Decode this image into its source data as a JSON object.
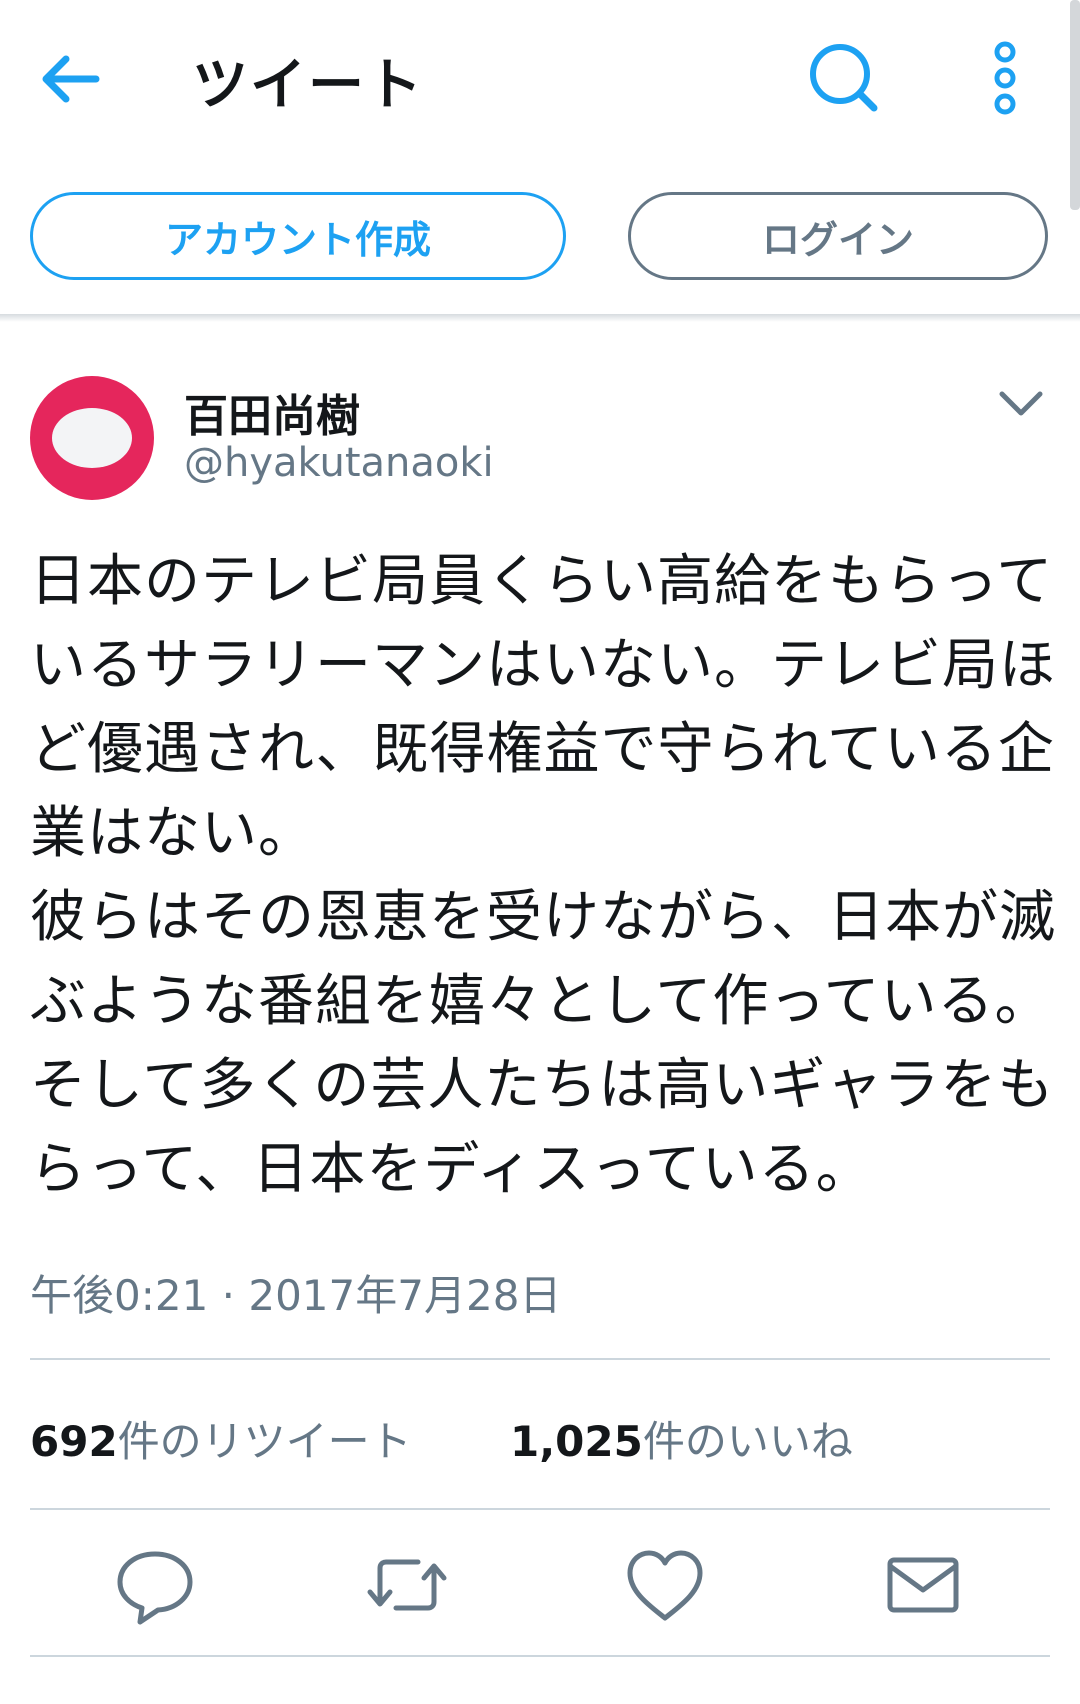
{
  "header": {
    "title": "ツイート",
    "back_icon": "arrow-left-icon",
    "search_icon": "search-icon",
    "more_icon": "more-vertical-icon"
  },
  "auth": {
    "signup_label": "アカウント作成",
    "login_label": "ログイン"
  },
  "tweet": {
    "display_name": "百田尚樹",
    "handle": "@hyakutanaoki",
    "text": "日本のテレビ局員くらい高給をもらって\nいるサラリーマンはいない。テレビ局ほ\nど優遇され、既得権益で守られている企\n業はない。\n彼らはその恩恵を受けながら、日本が滅\nぶような番組を嬉々として作っている。\nそして多くの芸人たちは高いギャラをも\nらって、日本をディスっている。",
    "timestamp": "午後0:21 · 2017年7月28日"
  },
  "stats": {
    "retweets_count": "692",
    "retweets_label": "件のリツイート",
    "likes_count": "1,025",
    "likes_label": "件のいいね"
  },
  "colors": {
    "accent": "#1da1f2",
    "muted": "#657786",
    "text": "#14171a",
    "avatar": "#e5265c"
  }
}
